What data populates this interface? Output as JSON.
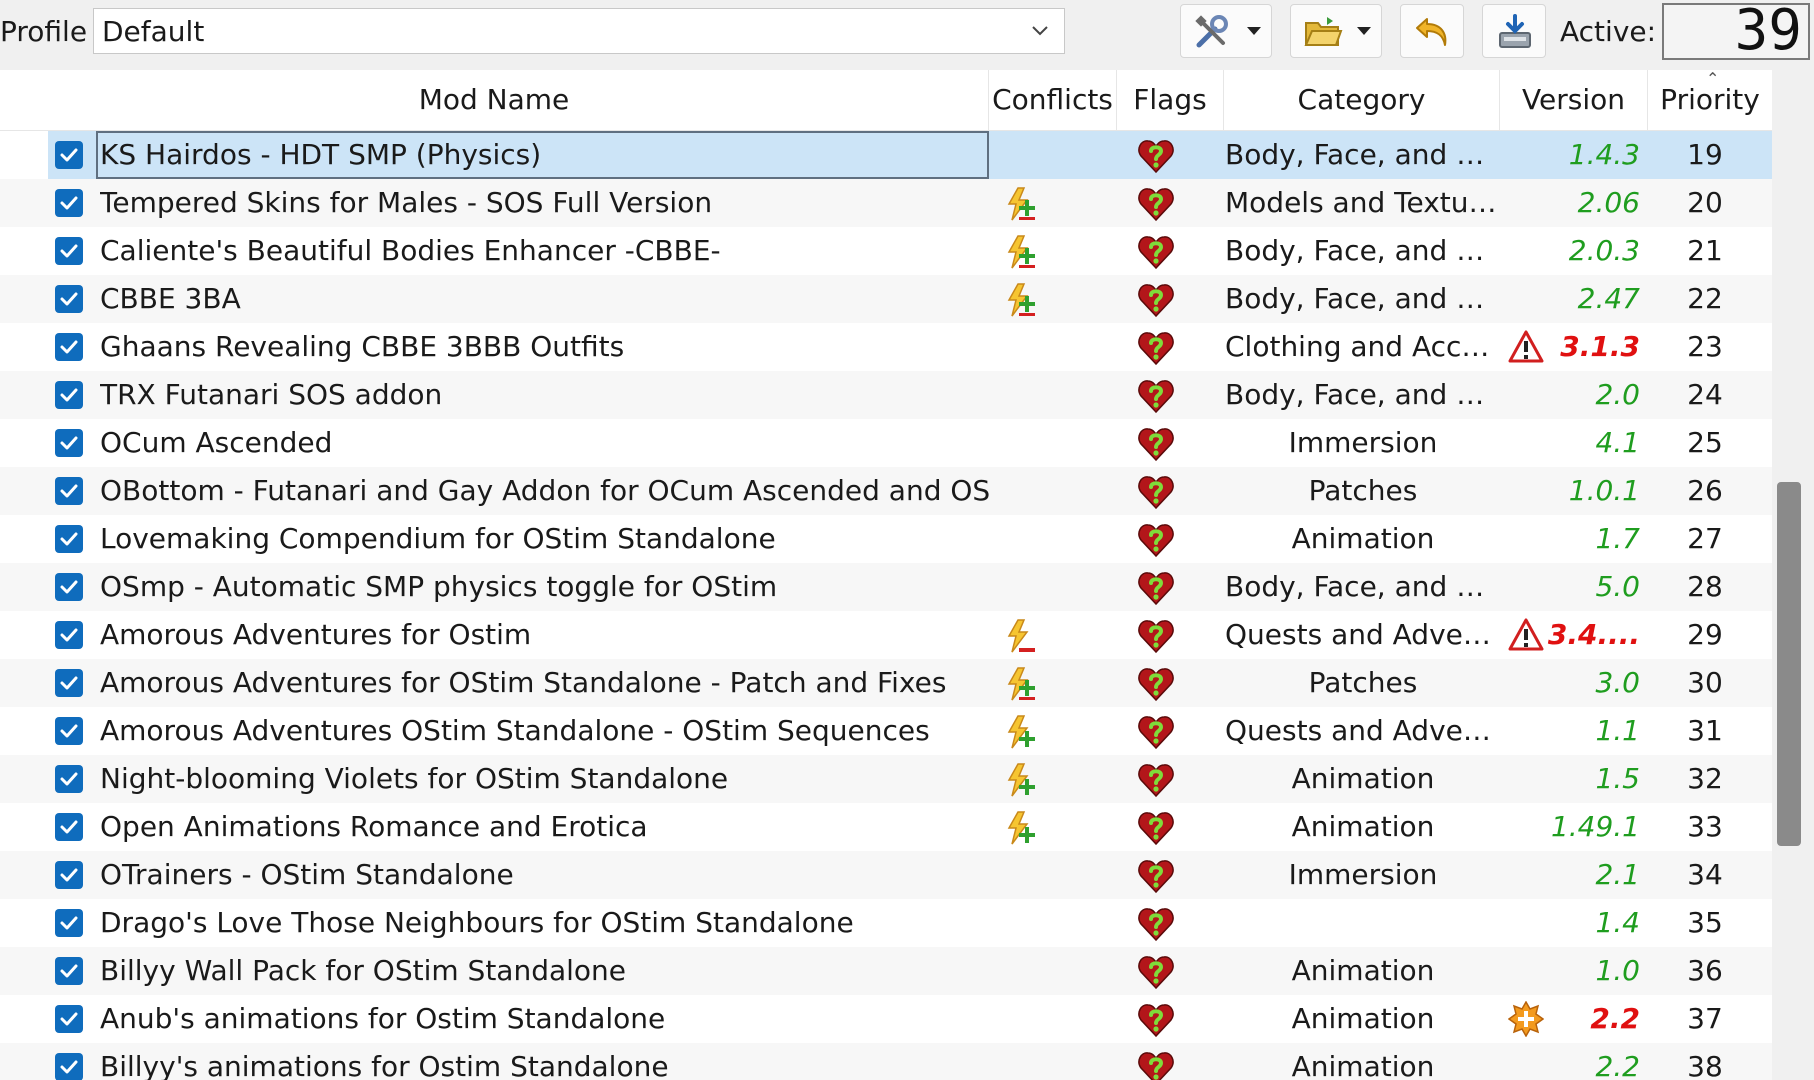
{
  "toolbar": {
    "profile_label": "Profile",
    "profile_value": "Default",
    "active_label": "Active:",
    "active_count": "39",
    "buttons": [
      {
        "name": "tools-button",
        "icon": "tools-icon"
      },
      {
        "name": "open-folder-button",
        "icon": "folder-icon"
      },
      {
        "name": "restore-backup-button",
        "icon": "undo-arrow-icon"
      },
      {
        "name": "create-backup-button",
        "icon": "save-disk-icon"
      }
    ]
  },
  "columns": {
    "mod_name": "Mod Name",
    "conflicts": "Conflicts",
    "flags": "Flags",
    "category": "Category",
    "version": "Version",
    "priority": "Priority"
  },
  "colors": {
    "version_ok": "#1f9d1f",
    "version_bad": "#e01010",
    "selection": "#cce4f7",
    "checkbox": "#0f6cbd"
  },
  "mods": [
    {
      "name": "KS Hairdos - HDT SMP (Physics)",
      "conflict": "",
      "category": "Body, Face, and Hair",
      "warn": "",
      "version": "1.4.3",
      "status": "ok",
      "priority": "19",
      "selected": true
    },
    {
      "name": "Tempered Skins for Males - SOS Full Version",
      "conflict": "overwrite-both",
      "category": "Models and Textures",
      "warn": "",
      "version": "2.06",
      "status": "ok",
      "priority": "20"
    },
    {
      "name": "Caliente's Beautiful Bodies Enhancer -CBBE-",
      "conflict": "overwrite-both",
      "category": "Body, Face, and Hair",
      "warn": "",
      "version": "2.0.3",
      "status": "ok",
      "priority": "21"
    },
    {
      "name": "CBBE 3BA",
      "conflict": "overwrite-both",
      "category": "Body, Face, and Hair",
      "warn": "",
      "version": "2.47",
      "status": "ok",
      "priority": "22"
    },
    {
      "name": "Ghaans Revealing CBBE 3BBB Outfits",
      "conflict": "",
      "category": "Clothing and Acce...",
      "warn": "warning",
      "version": "3.1.3",
      "status": "bad",
      "priority": "23"
    },
    {
      "name": "TRX Futanari SOS addon",
      "conflict": "",
      "category": "Body, Face, and Hair",
      "warn": "",
      "version": "2.0",
      "status": "ok",
      "priority": "24"
    },
    {
      "name": "OCum Ascended",
      "conflict": "",
      "category": "Immersion",
      "warn": "",
      "version": "4.1",
      "status": "ok",
      "priority": "25"
    },
    {
      "name": "OBottom - Futanari and Gay Addon for OCum Ascended and OStim...",
      "conflict": "",
      "category": "Patches",
      "warn": "",
      "version": "1.0.1",
      "status": "ok",
      "priority": "26"
    },
    {
      "name": "Lovemaking Compendium for OStim Standalone",
      "conflict": "",
      "category": "Animation",
      "warn": "",
      "version": "1.7",
      "status": "ok",
      "priority": "27"
    },
    {
      "name": "OSmp - Automatic SMP physics toggle for OStim",
      "conflict": "",
      "category": "Body, Face, and Hair",
      "warn": "",
      "version": "5.0",
      "status": "ok",
      "priority": "28"
    },
    {
      "name": "Amorous Adventures for Ostim",
      "conflict": "overwritten",
      "category": "Quests and Adven...",
      "warn": "warning",
      "version": "3.4....",
      "status": "bad",
      "priority": "29"
    },
    {
      "name": "Amorous Adventures for OStim Standalone - Patch and Fixes",
      "conflict": "overwrite-both",
      "category": "Patches",
      "warn": "",
      "version": "3.0",
      "status": "ok",
      "priority": "30"
    },
    {
      "name": "Amorous Adventures OStim Standalone - OStim Sequences",
      "conflict": "overwrites",
      "category": "Quests and Adven...",
      "warn": "",
      "version": "1.1",
      "status": "ok",
      "priority": "31"
    },
    {
      "name": "Night-blooming Violets for OStim Standalone",
      "conflict": "overwrites",
      "category": "Animation",
      "warn": "",
      "version": "1.5",
      "status": "ok",
      "priority": "32"
    },
    {
      "name": "Open Animations Romance and Erotica",
      "conflict": "overwrites",
      "category": "Animation",
      "warn": "",
      "version": "1.49.1",
      "status": "ok",
      "priority": "33"
    },
    {
      "name": "OTrainers - OStim Standalone",
      "conflict": "",
      "category": "Immersion",
      "warn": "",
      "version": "2.1",
      "status": "ok",
      "priority": "34"
    },
    {
      "name": "Drago's Love Those Neighbours for OStim Standalone",
      "conflict": "",
      "category": "",
      "warn": "",
      "version": "1.4",
      "status": "ok",
      "priority": "35"
    },
    {
      "name": "Billyy Wall Pack for OStim Standalone",
      "conflict": "",
      "category": "Animation",
      "warn": "",
      "version": "1.0",
      "status": "ok",
      "priority": "36"
    },
    {
      "name": "Anub's animations for Ostim Standalone",
      "conflict": "",
      "category": "Animation",
      "warn": "update",
      "version": "2.2",
      "status": "bad",
      "priority": "37"
    },
    {
      "name": "Billyy's animations for Ostim Standalone",
      "conflict": "",
      "category": "Animation",
      "warn": "",
      "version": "2.2",
      "status": "ok",
      "priority": "38"
    }
  ]
}
